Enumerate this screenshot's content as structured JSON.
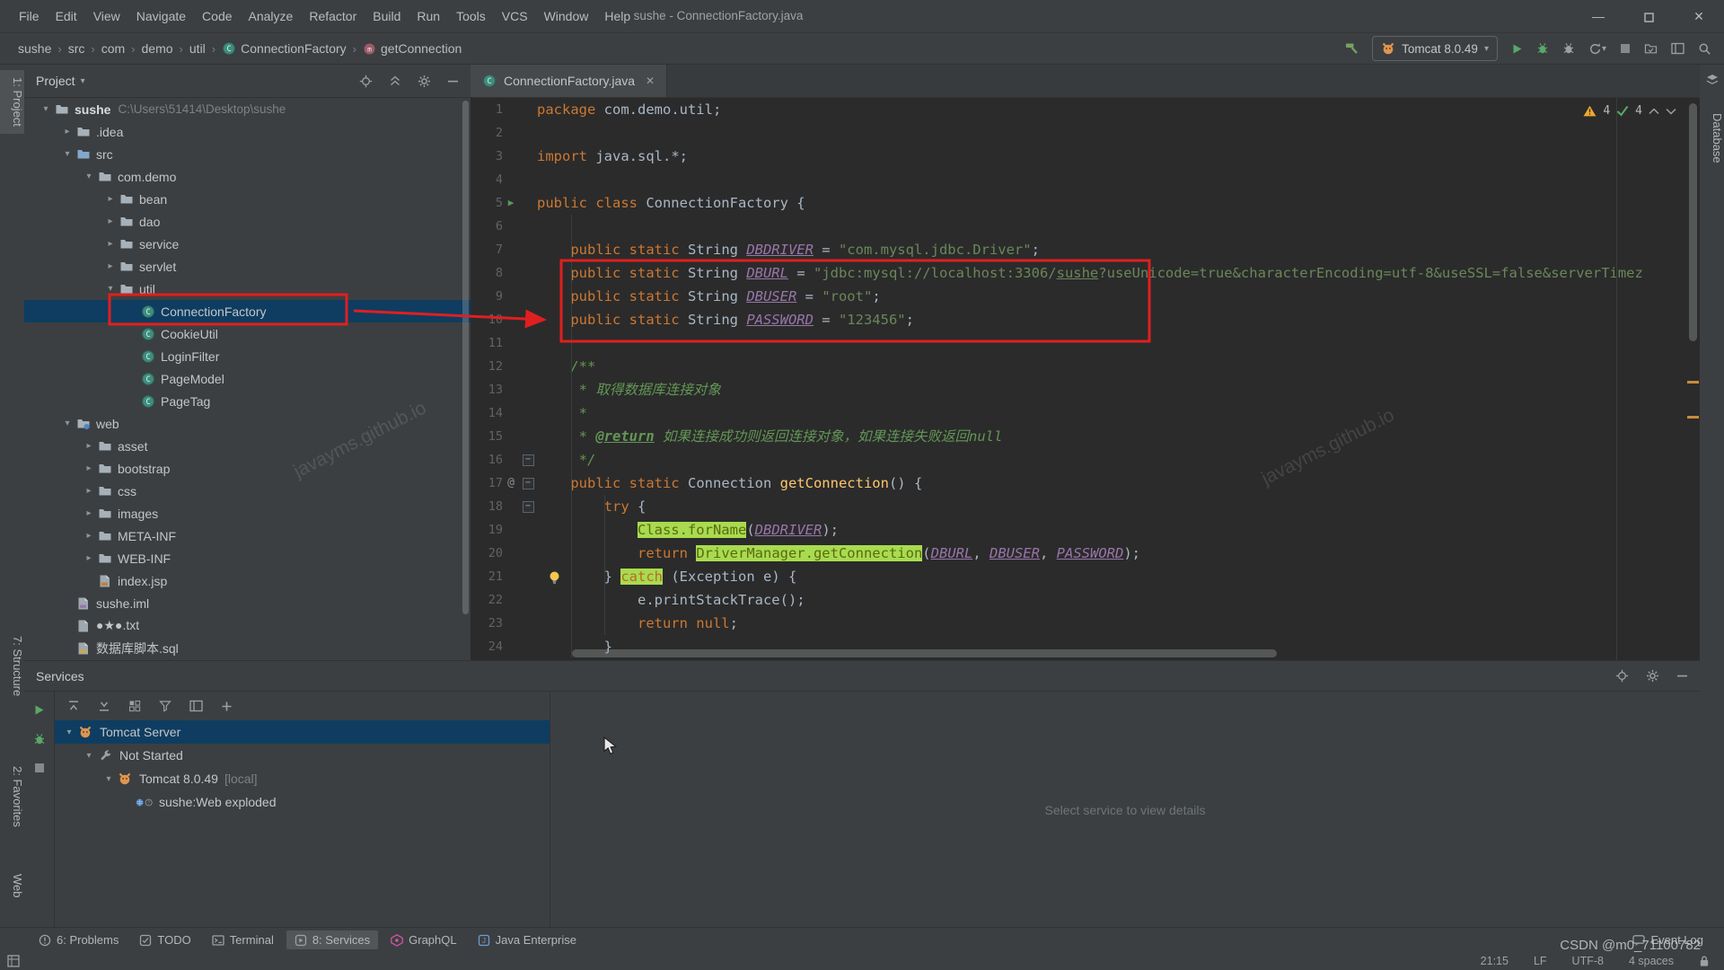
{
  "titlebar": {
    "menus": [
      "File",
      "Edit",
      "View",
      "Navigate",
      "Code",
      "Analyze",
      "Refactor",
      "Build",
      "Run",
      "Tools",
      "VCS",
      "Window",
      "Help"
    ],
    "title": "sushe - ConnectionFactory.java"
  },
  "navbar": {
    "breadcrumbs": [
      {
        "label": "sushe"
      },
      {
        "label": "src"
      },
      {
        "label": "com"
      },
      {
        "label": "demo"
      },
      {
        "label": "util"
      },
      {
        "label": "ConnectionFactory",
        "icon": "klass"
      },
      {
        "label": "getConnection",
        "icon": "method"
      }
    ],
    "run_config": "Tomcat 8.0.49"
  },
  "left_strip": [
    "1: Project",
    "7: Structure",
    "2: Favorites",
    "Web"
  ],
  "right_strip": [
    "Database"
  ],
  "project": {
    "title": "Project",
    "tree": [
      {
        "label": "sushe",
        "path": "C:\\Users\\51414\\Desktop\\sushe",
        "level": 0,
        "icon": "folder",
        "chev": "down",
        "root": true
      },
      {
        "label": ".idea",
        "level": 1,
        "icon": "folder",
        "chev": "right"
      },
      {
        "label": "src",
        "level": 1,
        "icon": "foldersrc",
        "chev": "down"
      },
      {
        "label": "com.demo",
        "level": 2,
        "icon": "folder",
        "chev": "down"
      },
      {
        "label": "bean",
        "level": 3,
        "icon": "folder",
        "chev": "right"
      },
      {
        "label": "dao",
        "level": 3,
        "icon": "folder",
        "chev": "right"
      },
      {
        "label": "service",
        "level": 3,
        "icon": "folder",
        "chev": "right"
      },
      {
        "label": "servlet",
        "level": 3,
        "icon": "folder",
        "chev": "right"
      },
      {
        "label": "util",
        "level": 3,
        "icon": "folder",
        "chev": "down"
      },
      {
        "label": "ConnectionFactory",
        "level": 4,
        "icon": "klass",
        "selected": true
      },
      {
        "label": "CookieUtil",
        "level": 4,
        "icon": "klass"
      },
      {
        "label": "LoginFilter",
        "level": 4,
        "icon": "klass"
      },
      {
        "label": "PageModel",
        "level": 4,
        "icon": "klass"
      },
      {
        "label": "PageTag",
        "level": 4,
        "icon": "klass"
      },
      {
        "label": "web",
        "level": 1,
        "icon": "folderweb",
        "chev": "down"
      },
      {
        "label": "asset",
        "level": 2,
        "icon": "folder",
        "chev": "right"
      },
      {
        "label": "bootstrap",
        "level": 2,
        "icon": "folder",
        "chev": "right"
      },
      {
        "label": "css",
        "level": 2,
        "icon": "folder",
        "chev": "right"
      },
      {
        "label": "images",
        "level": 2,
        "icon": "folder",
        "chev": "right"
      },
      {
        "label": "META-INF",
        "level": 2,
        "icon": "folder",
        "chev": "right"
      },
      {
        "label": "WEB-INF",
        "level": 2,
        "icon": "folder",
        "chev": "right"
      },
      {
        "label": "index.jsp",
        "level": 2,
        "icon": "docjsp"
      },
      {
        "label": "sushe.iml",
        "level": 1,
        "icon": "dociml"
      },
      {
        "label": "●★●.txt",
        "level": 1,
        "icon": "doctxt"
      },
      {
        "label": "数据库脚本.sql",
        "level": 1,
        "icon": "docsql"
      }
    ]
  },
  "editor": {
    "tab": "ConnectionFactory.java",
    "inspections": {
      "warnings": "4",
      "passed": "4"
    },
    "lines": [
      {
        "n": 1,
        "segs": [
          [
            "kw",
            "package"
          ],
          [
            "pl",
            " com.demo.util;"
          ]
        ]
      },
      {
        "n": 2,
        "segs": []
      },
      {
        "n": 3,
        "segs": [
          [
            "kw",
            "import"
          ],
          [
            "pl",
            " java.sql.*;"
          ]
        ]
      },
      {
        "n": 4,
        "segs": []
      },
      {
        "n": 5,
        "segs": [
          [
            "kw",
            "public class"
          ],
          [
            "pl",
            " ConnectionFactory {"
          ]
        ],
        "gutter": "run"
      },
      {
        "n": 6,
        "segs": []
      },
      {
        "n": 7,
        "segs": [
          [
            "pl",
            "    "
          ],
          [
            "kw",
            "public static"
          ],
          [
            "pl",
            " String "
          ],
          [
            "fld",
            "DBDRIVER"
          ],
          [
            "pl",
            " = "
          ],
          [
            "str",
            "\"com.mysql.jdbc.Driver\""
          ],
          [
            "pl",
            ";"
          ]
        ]
      },
      {
        "n": 8,
        "segs": [
          [
            "pl",
            "    "
          ],
          [
            "kw",
            "public static"
          ],
          [
            "pl",
            " String "
          ],
          [
            "fld",
            "DBURL"
          ],
          [
            "pl",
            " = "
          ],
          [
            "str",
            "\"jdbc:mysql://localhost:3306/"
          ],
          [
            "stru",
            "sushe"
          ],
          [
            "str",
            "?useUnicode=true&characterEncoding=utf-8&useSSL=false&serverTimez"
          ]
        ]
      },
      {
        "n": 9,
        "segs": [
          [
            "pl",
            "    "
          ],
          [
            "kw",
            "public static"
          ],
          [
            "pl",
            " String "
          ],
          [
            "fld",
            "DBUSER"
          ],
          [
            "pl",
            " = "
          ],
          [
            "str",
            "\"root\""
          ],
          [
            "pl",
            ";"
          ]
        ]
      },
      {
        "n": 10,
        "segs": [
          [
            "pl",
            "    "
          ],
          [
            "kw",
            "public static"
          ],
          [
            "pl",
            " String "
          ],
          [
            "fld",
            "PASSWORD"
          ],
          [
            "pl",
            " = "
          ],
          [
            "str",
            "\"123456\""
          ],
          [
            "pl",
            ";"
          ]
        ]
      },
      {
        "n": 11,
        "segs": []
      },
      {
        "n": 12,
        "segs": [
          [
            "cm",
            "    /**"
          ]
        ]
      },
      {
        "n": 13,
        "segs": [
          [
            "cm",
            "     * 取得数据库连接对象"
          ]
        ]
      },
      {
        "n": 14,
        "segs": [
          [
            "cm",
            "     *"
          ]
        ]
      },
      {
        "n": 15,
        "segs": [
          [
            "cm",
            "     * "
          ],
          [
            "tag",
            "@return"
          ],
          [
            "cm",
            " 如果连接成功则返回连接对象，如果连接失败返回null"
          ]
        ]
      },
      {
        "n": 16,
        "segs": [
          [
            "cm",
            "     */"
          ]
        ],
        "fold": true
      },
      {
        "n": 17,
        "segs": [
          [
            "pl",
            "    "
          ],
          [
            "kw",
            "public static"
          ],
          [
            "pl",
            " Connection "
          ],
          [
            "mth",
            "getConnection"
          ],
          [
            "pl",
            "() {"
          ]
        ],
        "gutter": "at",
        "fold": true
      },
      {
        "n": 18,
        "segs": [
          [
            "pl",
            "        "
          ],
          [
            "kw",
            "try"
          ],
          [
            "pl",
            " {"
          ]
        ],
        "fold": true
      },
      {
        "n": 19,
        "segs": [
          [
            "pl",
            "            "
          ],
          [
            "hl",
            "Class.forName"
          ],
          [
            "pl",
            "("
          ],
          [
            "fld",
            "DBDRIVER"
          ],
          [
            "pl",
            ");"
          ]
        ]
      },
      {
        "n": 20,
        "segs": [
          [
            "pl",
            "            "
          ],
          [
            "kw",
            "return"
          ],
          [
            "pl",
            " "
          ],
          [
            "hl",
            "DriverManager.getConnection"
          ],
          [
            "pl",
            "("
          ],
          [
            "fld",
            "DBURL"
          ],
          [
            "pl",
            ", "
          ],
          [
            "fld",
            "DBUSER"
          ],
          [
            "pl",
            ", "
          ],
          [
            "fld",
            "PASSWORD"
          ],
          [
            "pl",
            ");"
          ]
        ]
      },
      {
        "n": 21,
        "segs": [
          [
            "pl",
            "        } "
          ],
          [
            "hlkw",
            "catch"
          ],
          [
            "pl",
            " (Exception e) {"
          ]
        ],
        "bulb": true
      },
      {
        "n": 22,
        "segs": [
          [
            "pl",
            "            e.printStackTrace();"
          ]
        ]
      },
      {
        "n": 23,
        "segs": [
          [
            "pl",
            "            "
          ],
          [
            "kw",
            "return null"
          ],
          [
            "pl",
            ";"
          ]
        ]
      },
      {
        "n": 24,
        "segs": [
          [
            "pl",
            "        }"
          ]
        ]
      }
    ]
  },
  "services": {
    "title": "Services",
    "tree": [
      {
        "label": "Tomcat Server",
        "level": 0,
        "chev": "down",
        "icon": "tomcat",
        "selected": true
      },
      {
        "label": "Not Started",
        "level": 1,
        "chev": "down",
        "icon": "wrench"
      },
      {
        "label": "Tomcat 8.0.49",
        "suffix": "[local]",
        "level": 2,
        "chev": "down",
        "icon": "tomcat"
      },
      {
        "label": "sushe:Web exploded",
        "level": 3,
        "icon": "webexp"
      }
    ],
    "message": "Select service to view details"
  },
  "statusbar": {
    "tools": [
      {
        "icon": "problems",
        "label": "6: Problems"
      },
      {
        "icon": "todo",
        "label": "TODO"
      },
      {
        "icon": "terminal",
        "label": "Terminal"
      },
      {
        "icon": "services",
        "label": "8: Services",
        "active": true
      },
      {
        "icon": "graphql",
        "label": "GraphQL"
      },
      {
        "icon": "javaee",
        "label": "Java Enterprise"
      }
    ],
    "event_log": "Event Log",
    "info": [
      "21:15",
      "LF",
      "UTF-8",
      "4 spaces"
    ]
  },
  "watermarks": {
    "site": "javayms.github.io",
    "csdn": "CSDN @m0_71100782"
  },
  "colors": {
    "accent_red": "#E01F1F",
    "highlight_green": "#A8DB4F",
    "selection_blue": "#0E3D61"
  }
}
